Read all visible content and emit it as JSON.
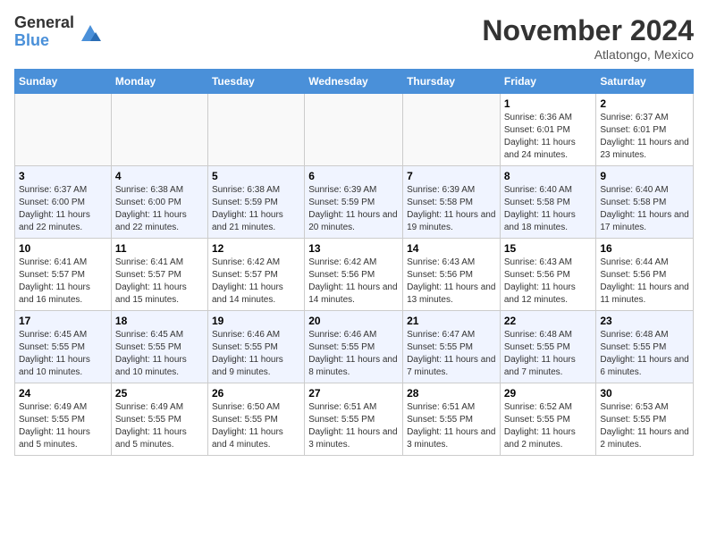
{
  "logo": {
    "general": "General",
    "blue": "Blue"
  },
  "title": "November 2024",
  "location": "Atlatongo, Mexico",
  "weekdays": [
    "Sunday",
    "Monday",
    "Tuesday",
    "Wednesday",
    "Thursday",
    "Friday",
    "Saturday"
  ],
  "weeks": [
    [
      {
        "day": "",
        "info": ""
      },
      {
        "day": "",
        "info": ""
      },
      {
        "day": "",
        "info": ""
      },
      {
        "day": "",
        "info": ""
      },
      {
        "day": "",
        "info": ""
      },
      {
        "day": "1",
        "info": "Sunrise: 6:36 AM\nSunset: 6:01 PM\nDaylight: 11 hours and 24 minutes."
      },
      {
        "day": "2",
        "info": "Sunrise: 6:37 AM\nSunset: 6:01 PM\nDaylight: 11 hours and 23 minutes."
      }
    ],
    [
      {
        "day": "3",
        "info": "Sunrise: 6:37 AM\nSunset: 6:00 PM\nDaylight: 11 hours and 22 minutes."
      },
      {
        "day": "4",
        "info": "Sunrise: 6:38 AM\nSunset: 6:00 PM\nDaylight: 11 hours and 22 minutes."
      },
      {
        "day": "5",
        "info": "Sunrise: 6:38 AM\nSunset: 5:59 PM\nDaylight: 11 hours and 21 minutes."
      },
      {
        "day": "6",
        "info": "Sunrise: 6:39 AM\nSunset: 5:59 PM\nDaylight: 11 hours and 20 minutes."
      },
      {
        "day": "7",
        "info": "Sunrise: 6:39 AM\nSunset: 5:58 PM\nDaylight: 11 hours and 19 minutes."
      },
      {
        "day": "8",
        "info": "Sunrise: 6:40 AM\nSunset: 5:58 PM\nDaylight: 11 hours and 18 minutes."
      },
      {
        "day": "9",
        "info": "Sunrise: 6:40 AM\nSunset: 5:58 PM\nDaylight: 11 hours and 17 minutes."
      }
    ],
    [
      {
        "day": "10",
        "info": "Sunrise: 6:41 AM\nSunset: 5:57 PM\nDaylight: 11 hours and 16 minutes."
      },
      {
        "day": "11",
        "info": "Sunrise: 6:41 AM\nSunset: 5:57 PM\nDaylight: 11 hours and 15 minutes."
      },
      {
        "day": "12",
        "info": "Sunrise: 6:42 AM\nSunset: 5:57 PM\nDaylight: 11 hours and 14 minutes."
      },
      {
        "day": "13",
        "info": "Sunrise: 6:42 AM\nSunset: 5:56 PM\nDaylight: 11 hours and 14 minutes."
      },
      {
        "day": "14",
        "info": "Sunrise: 6:43 AM\nSunset: 5:56 PM\nDaylight: 11 hours and 13 minutes."
      },
      {
        "day": "15",
        "info": "Sunrise: 6:43 AM\nSunset: 5:56 PM\nDaylight: 11 hours and 12 minutes."
      },
      {
        "day": "16",
        "info": "Sunrise: 6:44 AM\nSunset: 5:56 PM\nDaylight: 11 hours and 11 minutes."
      }
    ],
    [
      {
        "day": "17",
        "info": "Sunrise: 6:45 AM\nSunset: 5:55 PM\nDaylight: 11 hours and 10 minutes."
      },
      {
        "day": "18",
        "info": "Sunrise: 6:45 AM\nSunset: 5:55 PM\nDaylight: 11 hours and 10 minutes."
      },
      {
        "day": "19",
        "info": "Sunrise: 6:46 AM\nSunset: 5:55 PM\nDaylight: 11 hours and 9 minutes."
      },
      {
        "day": "20",
        "info": "Sunrise: 6:46 AM\nSunset: 5:55 PM\nDaylight: 11 hours and 8 minutes."
      },
      {
        "day": "21",
        "info": "Sunrise: 6:47 AM\nSunset: 5:55 PM\nDaylight: 11 hours and 7 minutes."
      },
      {
        "day": "22",
        "info": "Sunrise: 6:48 AM\nSunset: 5:55 PM\nDaylight: 11 hours and 7 minutes."
      },
      {
        "day": "23",
        "info": "Sunrise: 6:48 AM\nSunset: 5:55 PM\nDaylight: 11 hours and 6 minutes."
      }
    ],
    [
      {
        "day": "24",
        "info": "Sunrise: 6:49 AM\nSunset: 5:55 PM\nDaylight: 11 hours and 5 minutes."
      },
      {
        "day": "25",
        "info": "Sunrise: 6:49 AM\nSunset: 5:55 PM\nDaylight: 11 hours and 5 minutes."
      },
      {
        "day": "26",
        "info": "Sunrise: 6:50 AM\nSunset: 5:55 PM\nDaylight: 11 hours and 4 minutes."
      },
      {
        "day": "27",
        "info": "Sunrise: 6:51 AM\nSunset: 5:55 PM\nDaylight: 11 hours and 3 minutes."
      },
      {
        "day": "28",
        "info": "Sunrise: 6:51 AM\nSunset: 5:55 PM\nDaylight: 11 hours and 3 minutes."
      },
      {
        "day": "29",
        "info": "Sunrise: 6:52 AM\nSunset: 5:55 PM\nDaylight: 11 hours and 2 minutes."
      },
      {
        "day": "30",
        "info": "Sunrise: 6:53 AM\nSunset: 5:55 PM\nDaylight: 11 hours and 2 minutes."
      }
    ]
  ]
}
